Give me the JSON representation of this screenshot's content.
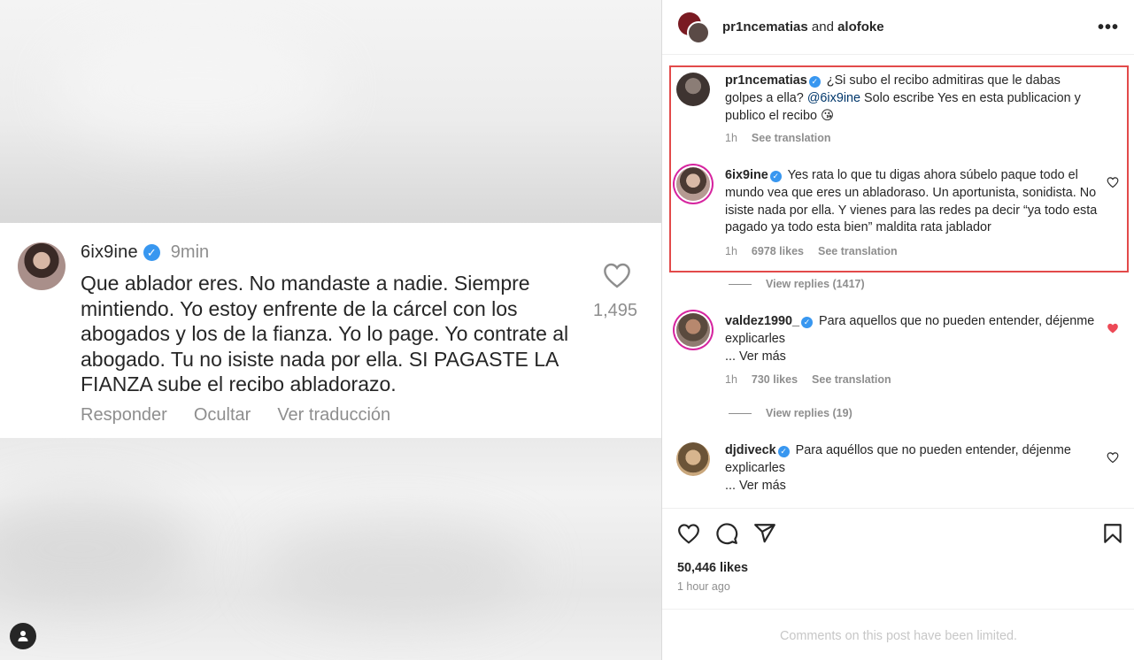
{
  "post_image": {
    "card": {
      "username": "6ix9ine",
      "time": "9min",
      "text": "Que ablador eres. No mandaste a nadie. Siempre mintiendo. Yo estoy enfrente de la cárcel con los abogados y los de la fianza. Yo lo page. Yo contrate al abogado. Tu no isiste nada por ella. SI PAGASTE LA FIANZA sube el recibo abladorazo.",
      "like_count": "1,495",
      "actions": {
        "reply": "Responder",
        "hide": "Ocultar",
        "translate": "Ver traducción"
      }
    }
  },
  "header": {
    "user1": "pr1ncematias",
    "joiner": "and",
    "user2": "alofoke",
    "more_icon": "more-icon"
  },
  "comments": [
    {
      "username": "pr1ncematias",
      "text_before": "¿Si subo el recibo admitiras que le dabas golpes a ella?",
      "mention": "@6ix9ine",
      "text_after": "Solo escribe Yes en esta publicacion y publico el recibo 😘",
      "time": "1h",
      "see_translation": "See translation"
    },
    {
      "username": "6ix9ine",
      "text": "Yes rata lo que tu digas ahora súbelo paque todo el mundo vea que eres un abladoraso. Un aportunista, sonidista. No isiste nada por ella. Y vienes para las redes pa decir “ya todo esta pagado ya todo esta bien” maldita rata jablador",
      "time": "1h",
      "likes": "6978 likes",
      "see_translation": "See translation",
      "view_replies": "View replies (1417)"
    },
    {
      "username": "valdez1990_",
      "text": "Para aquellos que no pueden entender, déjenme explicarles",
      "more": "... Ver más",
      "time": "1h",
      "likes": "730 likes",
      "see_translation": "See translation",
      "view_replies": "View replies (19)",
      "liked_color": "#ed4956"
    },
    {
      "username": "djdiveck",
      "text": "Para aquéllos que no pueden entender, déjenme explicarles",
      "more": "... Ver más"
    }
  ],
  "footer": {
    "likes": "50,446 likes",
    "ago": "1 hour ago",
    "limited": "Comments on this post have been limited."
  },
  "colors": {
    "highlight_border": "#e24a4a",
    "verified": "#3897f0",
    "muted": "#8e8e8e",
    "mention": "#00376b"
  }
}
